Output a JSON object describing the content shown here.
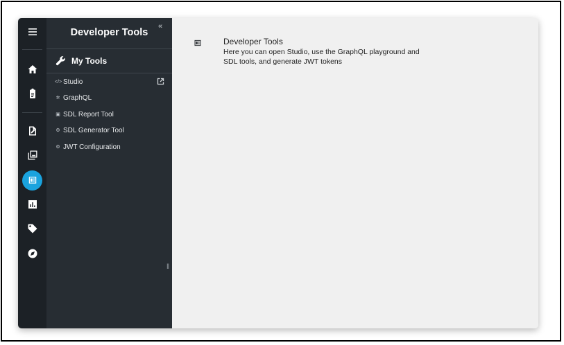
{
  "panel": {
    "title": "Developer Tools",
    "collapse_glyph": "«",
    "section_title": "My Tools",
    "items": [
      {
        "label": "Studio",
        "icon_glyph": "</>",
        "icon": "code-icon",
        "external": true
      },
      {
        "label": "GraphQL",
        "icon_glyph": "✲",
        "icon": "graphql-icon"
      },
      {
        "label": "SDL Report Tool",
        "icon_glyph": "▣",
        "icon": "report-icon"
      },
      {
        "label": "SDL Generator Tool",
        "icon_glyph": "⚙",
        "icon": "generator-icon"
      },
      {
        "label": "JWT Configuration",
        "icon_glyph": "⚙",
        "icon": "settings-icon"
      }
    ],
    "resize_glyph": "‖"
  },
  "rail": {
    "icons": [
      "menu-icon",
      "home-icon",
      "clipboard-icon",
      "edit-document-icon",
      "image-gallery-icon",
      "developer-tools-icon",
      "analytics-icon",
      "tag-icon",
      "compass-icon"
    ],
    "active": "developer-tools-icon",
    "active_color": "#1aa3de"
  },
  "main": {
    "title": "Developer Tools",
    "description": "Here you can open Studio, use the GraphQL playground and SDL tools, and generate JWT tokens"
  }
}
